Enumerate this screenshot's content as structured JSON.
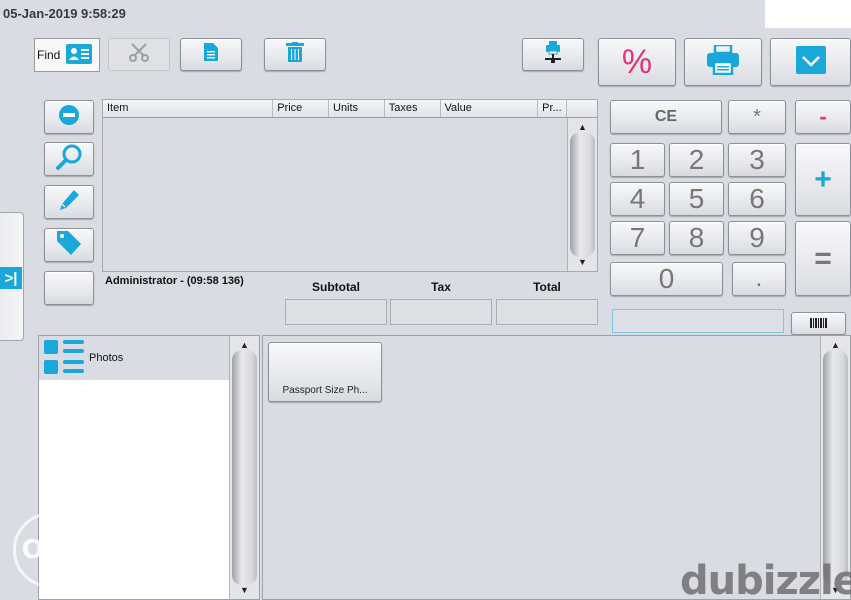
{
  "header": {
    "datetime": "05-Jan-2019 9:58:29"
  },
  "toolbar": {
    "find_label": "Find",
    "icons": [
      "customer-card-icon",
      "scissors-icon",
      "document-icon",
      "trash-icon",
      "network-printer-icon",
      "percent-icon",
      "printer-icon",
      "checkmark-icon"
    ]
  },
  "ticket": {
    "columns": [
      "Item",
      "Price",
      "Units",
      "Taxes",
      "Value",
      "Pr..."
    ],
    "rows": [],
    "user_label": "Administrator - (09:58 136)",
    "totals": {
      "subtotal_label": "Subtotal",
      "tax_label": "Tax",
      "total_label": "Total",
      "subtotal_value": "",
      "tax_value": "",
      "total_value": ""
    }
  },
  "line_actions": [
    "remove-line-icon",
    "search-icon",
    "edit-icon",
    "tag-icon",
    ""
  ],
  "keypad": {
    "ce": "CE",
    "multiply": "*",
    "minus": "-",
    "plus": "+",
    "equals": "=",
    "digits": [
      "1",
      "2",
      "3",
      "4",
      "5",
      "6",
      "7",
      "8",
      "9",
      "0"
    ],
    "dot": ".",
    "input_value": "",
    "barcode_icon": "barcode-icon"
  },
  "colors": {
    "accent_blue": "#1aa7d9",
    "accent_pink": "#e6327a"
  },
  "categories": [
    {
      "label": "Photos"
    }
  ],
  "products": [
    {
      "label": "Passport Size Ph..."
    }
  ],
  "watermarks": {
    "left": "OLX",
    "right": "dubizzle"
  }
}
